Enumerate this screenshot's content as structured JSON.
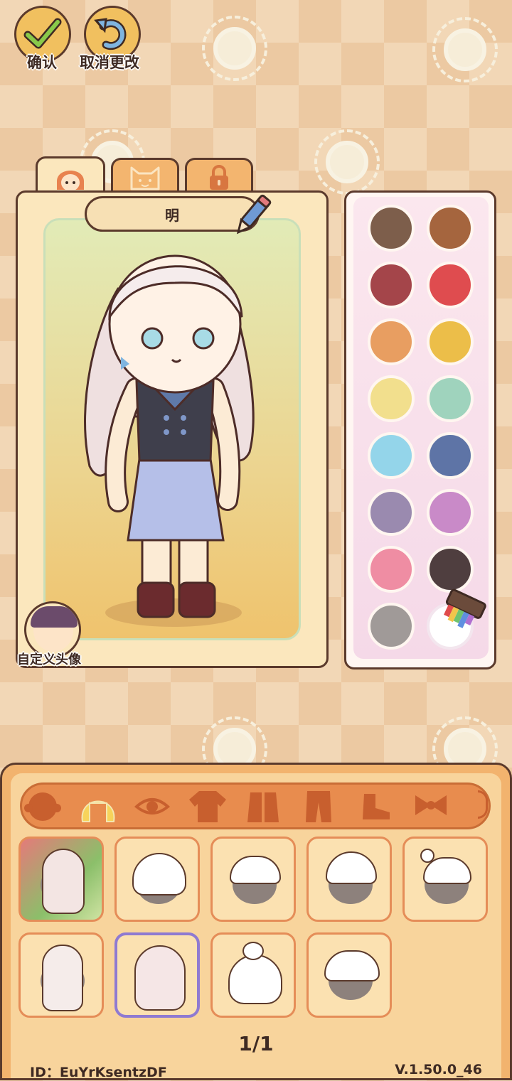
{
  "top": {
    "confirm_label": "确认",
    "cancel_label": "取消更改"
  },
  "character": {
    "name": "明",
    "custom_avatar_label": "自定义头像"
  },
  "tabs": [
    {
      "icon": "avatar-face-icon"
    },
    {
      "icon": "cat-face-icon"
    },
    {
      "icon": "lock-icon"
    }
  ],
  "palette": [
    "#7d5e4b",
    "#a5653e",
    "#a4454a",
    "#df4c4f",
    "#e89e61",
    "#ecbe49",
    "#f2df8d",
    "#9fd3bd",
    "#94d5ea",
    "#5e74a6",
    "#9a8aaf",
    "#c98ac8",
    "#ef8da3",
    "#4f3e3f",
    "#a09a98",
    "#ffffff"
  ],
  "categories": [
    "head-icon",
    "hair-icon",
    "eye-icon",
    "shirt-icon",
    "coat-icon",
    "pants-icon",
    "shoe-icon",
    "bow-icon"
  ],
  "page_indicator": "1/1",
  "footer": {
    "id_label": "ID：EuYrKsentzDF",
    "version": "V.1.50.0_46"
  },
  "accent": "#8f7ad1"
}
